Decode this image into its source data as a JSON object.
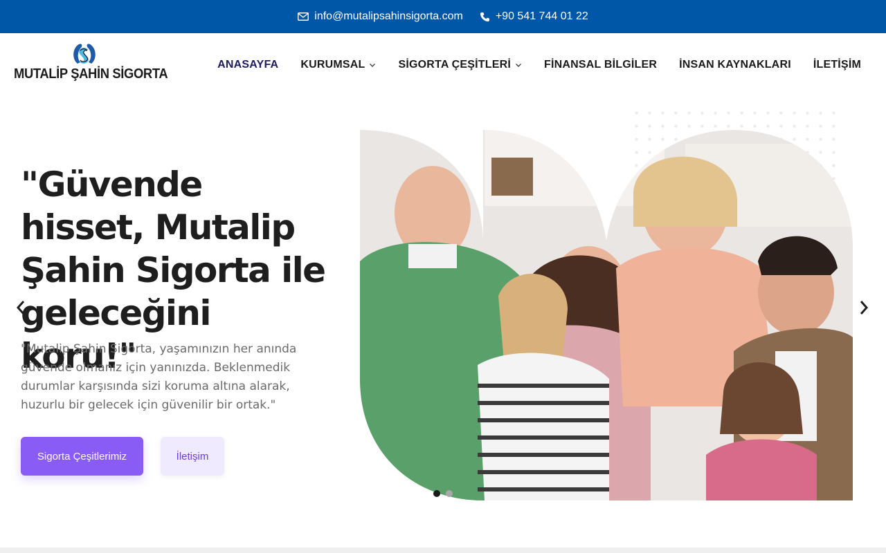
{
  "topbar": {
    "email": "info@mutalipsahinsigorta.com",
    "phone": "+90 541 744 01 22",
    "background": "#0057a8"
  },
  "logo": {
    "text": "MUTALİP ŞAHİN SİGORTA"
  },
  "nav": {
    "items": [
      {
        "label": "ANASAYFA",
        "active": true,
        "dropdown": false
      },
      {
        "label": "KURUMSAL",
        "active": false,
        "dropdown": true
      },
      {
        "label": "SİGORTA ÇEŞİTLERİ",
        "active": false,
        "dropdown": true
      },
      {
        "label": "FİNANSAL BİLGİLER",
        "active": false,
        "dropdown": false
      },
      {
        "label": "İNSAN KAYNAKLARI",
        "active": false,
        "dropdown": false
      },
      {
        "label": "İLETİŞİM",
        "active": false,
        "dropdown": false
      }
    ]
  },
  "hero": {
    "headline": "\"Güvende hisset, Mutalip Şahin Sigorta ile geleceğini koru!\"",
    "subtitle": "\"Mutalip Şahin Sigorta, yaşamınızın her anında güvende olmanız için yanınızda. Beklenmedik durumlar karşısında sizi koruma altına alarak, huzurlu bir gelecek için güvenilir bir ortak.\"",
    "primary_button": "Sigorta Çeşitlerimiz",
    "secondary_button": "İletişim",
    "slide_count": 2,
    "active_slide": 1
  },
  "colors": {
    "accent": "#8a5cf6",
    "accent_light": "#efeafd",
    "nav_active": "#1d1b5e"
  }
}
